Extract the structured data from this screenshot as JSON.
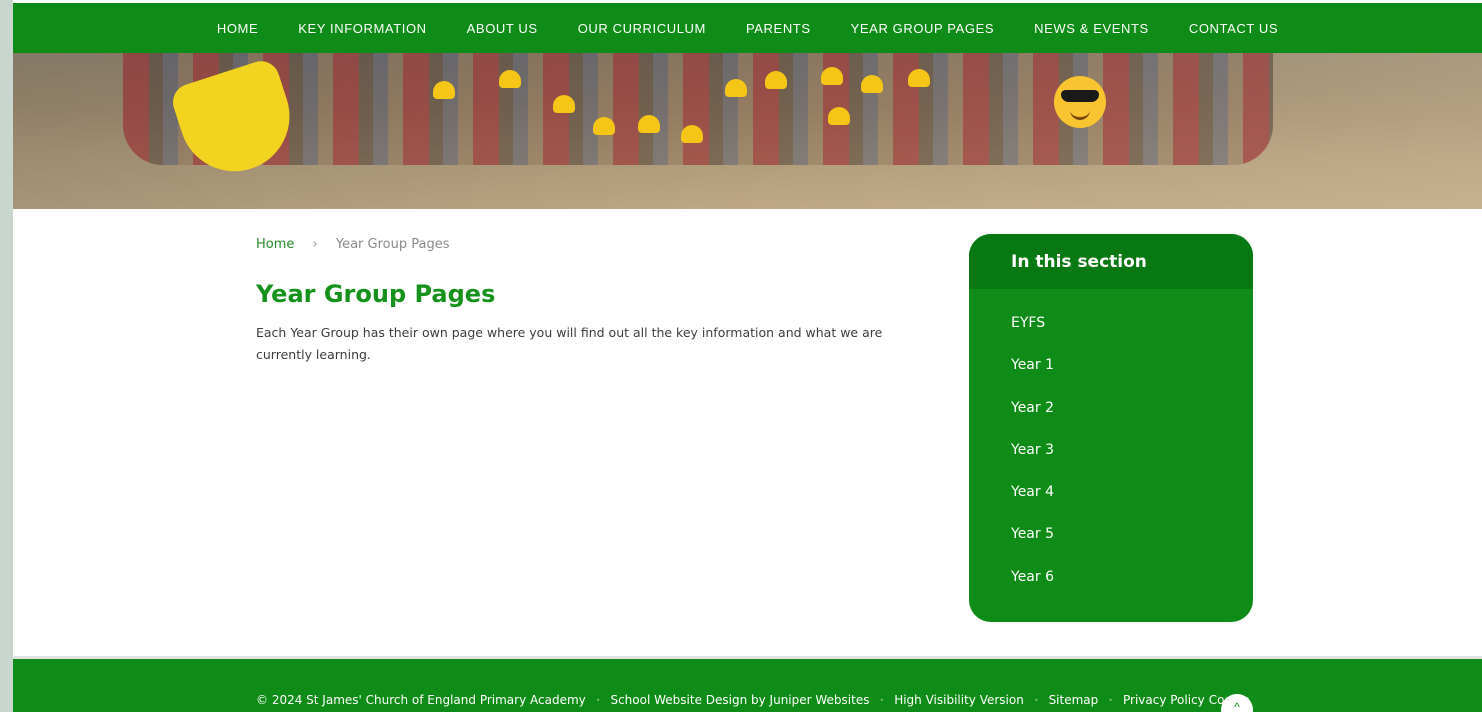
{
  "nav": {
    "items": [
      {
        "label": "HOME"
      },
      {
        "label": "KEY INFORMATION"
      },
      {
        "label": "ABOUT US"
      },
      {
        "label": "OUR CURRICULUM"
      },
      {
        "label": "PARENTS"
      },
      {
        "label": "YEAR GROUP PAGES"
      },
      {
        "label": "NEWS & EVENTS"
      },
      {
        "label": "CONTACT US"
      }
    ]
  },
  "breadcrumb": {
    "home": "Home",
    "separator": "›",
    "current": "Year Group Pages"
  },
  "page": {
    "title": "Year Group Pages",
    "intro": "Each Year Group has their own page where you will find out all the key information and what we are currently learning."
  },
  "sidebar": {
    "heading": "In this section",
    "links": [
      {
        "label": "EYFS"
      },
      {
        "label": "Year 1"
      },
      {
        "label": "Year 2"
      },
      {
        "label": "Year 3"
      },
      {
        "label": "Year 4"
      },
      {
        "label": "Year 5"
      },
      {
        "label": "Year 6"
      }
    ]
  },
  "footer": {
    "copyright": "© 2024 St James' Church of England Primary Academy",
    "design_credit": "School Website Design by Juniper Websites",
    "high_vis": "High Visibility Version",
    "sitemap": "Sitemap",
    "privacy": "Privacy Policy",
    "cookie": "Cookie",
    "separator": "•",
    "back_to_top": "^"
  },
  "colors": {
    "brand_green": "#0f8c17",
    "title_green": "#16921c",
    "sidebar_header": "#087812"
  },
  "icons": {
    "back_to_top": "chevron-up-icon"
  }
}
